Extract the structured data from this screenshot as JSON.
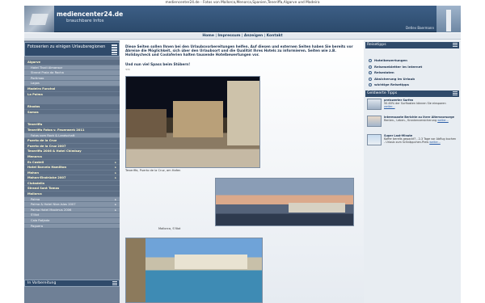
{
  "window": {
    "title": "mediencenter24.de - Fotos von Mallorca,Menorca,Spanien,Teneriffa,Algarve und Madeira"
  },
  "header": {
    "site_title": "mediencenter24.de",
    "subtitle": "brauchbare Infos",
    "author": "Detlev Baermann"
  },
  "topnav": {
    "items": [
      "Home",
      "Impressum",
      "Anzeigen",
      "Kontakt"
    ],
    "separator": "|"
  },
  "left": {
    "heading": "Fotoserien zu einigen Urlaubsregionen",
    "menu": [
      {
        "label": "Algarve",
        "kind": "grp",
        "arrow": ""
      },
      {
        "label": "Hotel Tivoli Almansor",
        "kind": "sub",
        "arrow": ""
      },
      {
        "label": "Strand Praia da Rocha",
        "kind": "sub",
        "arrow": ""
      },
      {
        "label": "Portimao",
        "kind": "sub",
        "arrow": ""
      },
      {
        "label": "Lagos",
        "kind": "sub",
        "arrow": ""
      },
      {
        "label": "Madeira Funchal",
        "kind": "grp",
        "arrow": ""
      },
      {
        "label": "La Palma",
        "kind": "grp",
        "arrow": ""
      },
      {
        "label": "",
        "kind": "gap",
        "arrow": ""
      },
      {
        "label": "Rhodos",
        "kind": "grp",
        "arrow": ""
      },
      {
        "label": "Samos",
        "kind": "grp",
        "arrow": ""
      },
      {
        "label": "",
        "kind": "gap",
        "arrow": ""
      },
      {
        "label": "Teneriffa",
        "kind": "grp",
        "arrow": ""
      },
      {
        "label": "Teneriffa Fotos v. Feuerwerk 2011",
        "kind": "grp",
        "arrow": ""
      },
      {
        "label": "Fotos vom Rock & Landschaft",
        "kind": "sub",
        "arrow": ""
      },
      {
        "label": "Puerto de la Cruz",
        "kind": "grp",
        "arrow": ""
      },
      {
        "label": "Puerto de la Cruz 2007",
        "kind": "grp",
        "arrow": ""
      },
      {
        "label": "Teneriffa 2006 & Hotel Chimisay",
        "kind": "grp",
        "arrow": ""
      },
      {
        "label": "Menorca",
        "kind": "grp",
        "arrow": ""
      },
      {
        "label": "Es Castell",
        "kind": "grp",
        "arrow": "▸"
      },
      {
        "label": "Hotel Barcelo Hamilton",
        "kind": "grp",
        "arrow": "▸"
      },
      {
        "label": "Mahon",
        "kind": "grp",
        "arrow": "▸"
      },
      {
        "label": "Mahon-Eindrücke 2007",
        "kind": "grp",
        "arrow": "▸"
      },
      {
        "label": "Ciutadella",
        "kind": "grp",
        "arrow": ""
      },
      {
        "label": "Strand Sant Tomas",
        "kind": "grp",
        "arrow": ""
      },
      {
        "label": "Mallorca",
        "kind": "grp",
        "arrow": ""
      },
      {
        "label": "Palma",
        "kind": "sub",
        "arrow": "▸"
      },
      {
        "label": "Palma & Hotel Nixe-Islas 2007",
        "kind": "sub",
        "arrow": "▸"
      },
      {
        "label": "Palma Hotel Maximus 2006",
        "kind": "sub",
        "arrow": "▸"
      },
      {
        "label": "S'Illot",
        "kind": "sub",
        "arrow": ""
      },
      {
        "label": "Cala Ratjada",
        "kind": "sub",
        "arrow": ""
      },
      {
        "label": "Paguera",
        "kind": "sub",
        "arrow": ""
      }
    ],
    "prep_label": "In Vorbereitung"
  },
  "content": {
    "intro": "Diese Seiten sollen Ihnen bei den Urlaubsvorbereitungen helfen. Auf diesen und externen Seiten haben Sie bereits vor Abreise die Möglichkeit, sich über den Urlaubsort und die Qualität Ihres Hotels zu informieren. Seiten wie z.B. Holidaycheck und Coolaferien halten tausende Hotelbewertungen vor.",
    "question": "Und nun viel Spass beim Stöbern!",
    "question_sub": "<<",
    "caption1": "Teneriffa, Puerto de la Cruz, am Hafen",
    "caption2": "Mallorca, S'Illot"
  },
  "right": {
    "tips_heading": "Reisetipps",
    "links": [
      "Hotelbewertungen",
      "Reisewebletter im Internet",
      "Reisedaten",
      "Absicherung im Urlaub",
      "wichtige Reisetipps"
    ],
    "money_heading": "Geldwerte Tipps",
    "tips": [
      {
        "title": "preiswerter Surfen",
        "text": "50-60% der Surfkosten können Sie einsparen",
        "more": "weiter..."
      },
      {
        "title": "interessante Berichte zu Ihrer Altersvorsorge",
        "text": "Renten-, Leben-, Krankenversicherung",
        "more": "weiter..."
      },
      {
        "title": "Super Last-Minute",
        "text": "Koffer bereits gepackt? - 2-3 Tage vor Abflug buchen - Urlaub zum Schnäppchen-Preis",
        "more": "weiter..."
      }
    ]
  }
}
